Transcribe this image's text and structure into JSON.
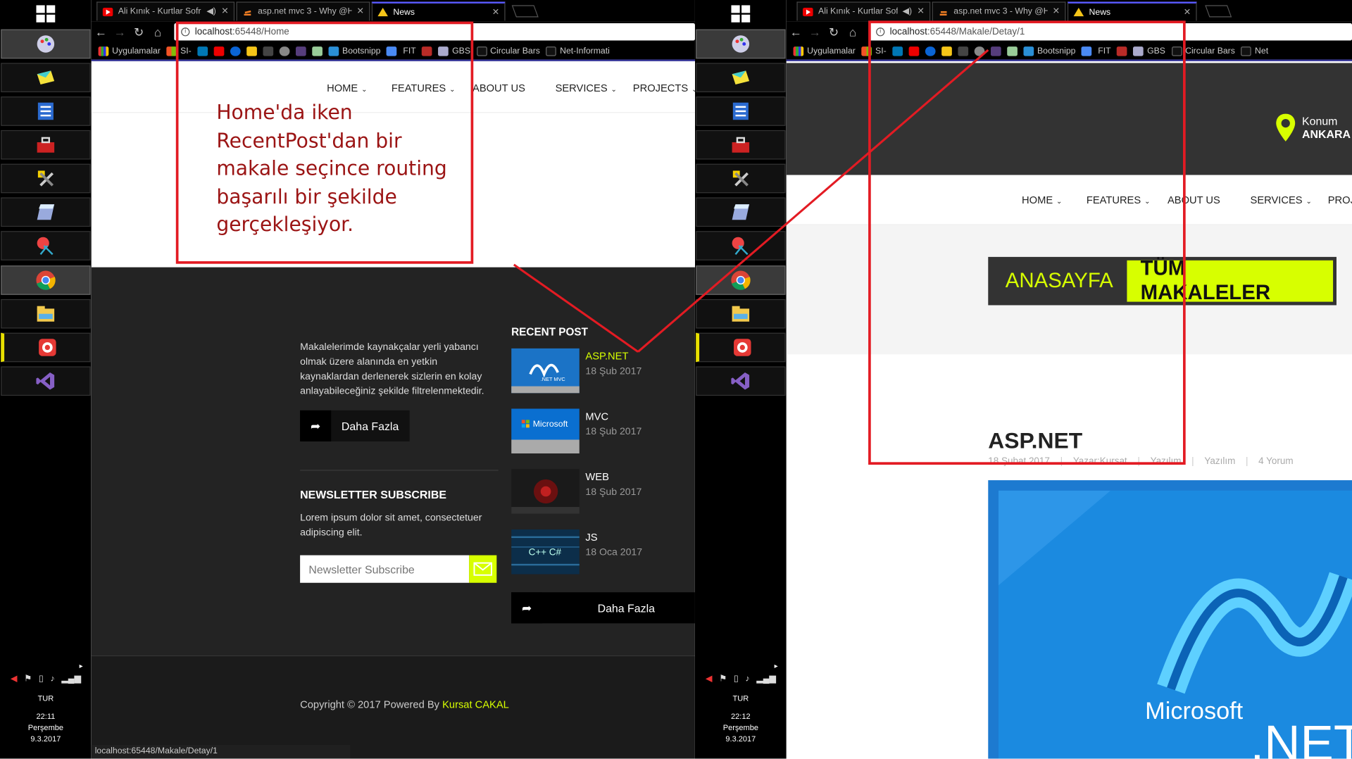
{
  "colors": {
    "accent": "#d7ff00",
    "annotation": "#e31b23",
    "annotation_text": "#9b1414",
    "dark_footer": "#232323"
  },
  "screens": [
    {
      "tabs": [
        {
          "title": "Ali Kınık - Kurtlar Sofr",
          "icon": "youtube-icon"
        },
        {
          "title": "asp.net mvc 3 - Why @H",
          "icon": "stackoverflow-icon"
        },
        {
          "title": "News",
          "icon": "news-icon",
          "active": true
        }
      ],
      "url_host": "localhost",
      "url_path": ":65448/Home",
      "bookmarks": [
        "Uygulamalar",
        "SI-",
        "",
        "",
        "",
        "",
        "",
        "",
        "",
        "",
        "Bootsnipp",
        "",
        "FIT",
        "",
        "GBS",
        "Circular Bars",
        "Net-Informati"
      ],
      "nav": [
        "HOME",
        "FEATURES",
        "ABOUT US",
        "SERVICES",
        "PROJECTS"
      ],
      "annotation": "Home'da iken RecentPost'dan bir makale seçince routing başarılı bir şekilde gerçekleşiyor.",
      "about_text": "Makalelerimde kaynakçalar yerli yabancı olmak üzere alanında en yetkin kaynaklardan derlenerek sizlerin en kolay anlayabileceğiniz şekilde filtrelenmektedir.",
      "more_label": "Daha Fazla",
      "newsletter_title": "NEWSLETTER SUBSCRIBE",
      "newsletter_text": "Lorem ipsum dolor sit amet, consectetuer adipiscing elit.",
      "newsletter_placeholder": "Newsletter Subscribe",
      "recent_title": "RECENT POST",
      "recent_posts": [
        {
          "title": "ASP.NET",
          "date": "18 Şub 2017",
          "thumb_text": ".NET MVC"
        },
        {
          "title": "MVC",
          "date": "18 Şub 2017",
          "thumb_text": "Microsoft"
        },
        {
          "title": "WEB",
          "date": "18 Şub 2017",
          "thumb_text": ""
        },
        {
          "title": "JS",
          "date": "18 Oca 2017",
          "thumb_text": "C++ C#"
        }
      ],
      "recent_more_label": "Daha Fazla",
      "copyright": "Copyright © 2017 Powered By ",
      "copyright_brand": "Kursat CAKAL",
      "status_url": "localhost:65448/Makale/Detay/1",
      "tray": {
        "lang": "TUR",
        "time": "22:11",
        "day": "Perşembe",
        "date": "9.3.2017"
      }
    },
    {
      "tabs": [
        {
          "title": "Ali Kınık - Kurtlar Sofr",
          "icon": "youtube-icon"
        },
        {
          "title": "asp.net mvc 3 - Why @H",
          "icon": "stackoverflow-icon"
        },
        {
          "title": "News",
          "icon": "news-icon",
          "active": true
        }
      ],
      "url_host": "localhost",
      "url_path": ":65448/Makale/Detay/1",
      "bookmarks": [
        "Uygulamalar",
        "SI-",
        "",
        "",
        "",
        "",
        "",
        "",
        "",
        "",
        "Bootsnipp",
        "",
        "FIT",
        "",
        "GBS",
        "Circular Bars",
        "Net"
      ],
      "location_label": "Konum",
      "location_value": "ANKARA",
      "nav": [
        "HOME",
        "FEATURES",
        "ABOUT US",
        "SERVICES",
        "PROJ"
      ],
      "breadcrumb_home": "ANASAYFA",
      "breadcrumb_all": "TÜM MAKALELER",
      "article_title": "ASP.NET",
      "meta": [
        "18 Şubat 2017",
        "Yazar:Kursat",
        "Yazılım",
        "Yazılım",
        "4 Yorum"
      ],
      "hero_brand": "Microsoft",
      "hero_net": ".NET",
      "tray": {
        "lang": "TUR",
        "time": "22:12",
        "day": "Perşembe",
        "date": "9.3.2017"
      }
    }
  ]
}
